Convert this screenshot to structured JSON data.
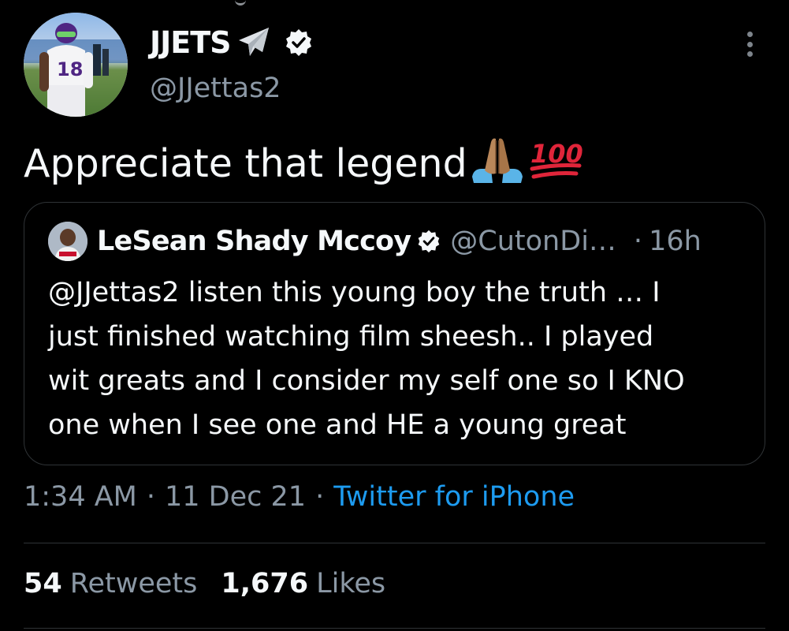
{
  "author": {
    "display_name": "JJETS",
    "handle": "@JJettas2",
    "name_emoji": "airplane-icon",
    "verified": true,
    "jersey_number": "18"
  },
  "tweet": {
    "text": "Appreciate that legend",
    "emojis": [
      "folded-hands-icon",
      "hundred-points-icon"
    ]
  },
  "quoted_tweet": {
    "author_name": "LeSean Shady Mccoy",
    "author_handle": "@CutonDi…",
    "separator": "·",
    "time": "16h",
    "verified": true,
    "text_lines": [
      "@JJettas2 listen this young boy the truth … I",
      "just finished watching film sheesh.. I played",
      "wit greats and I consider my self one so I KNO",
      "one when I see one and HE a young great"
    ]
  },
  "meta": {
    "time": "1:34 AM",
    "separator": "·",
    "date": "11 Dec 21",
    "source": "Twitter for iPhone"
  },
  "stats": {
    "retweets_count": "54",
    "retweets_label": "Retweets",
    "likes_count": "1,676",
    "likes_label": "Likes"
  },
  "colors": {
    "background": "#000000",
    "text_primary": "#f5f8fa",
    "text_secondary": "#8b98a5",
    "link": "#1d9bf0",
    "border": "#2f3336"
  }
}
